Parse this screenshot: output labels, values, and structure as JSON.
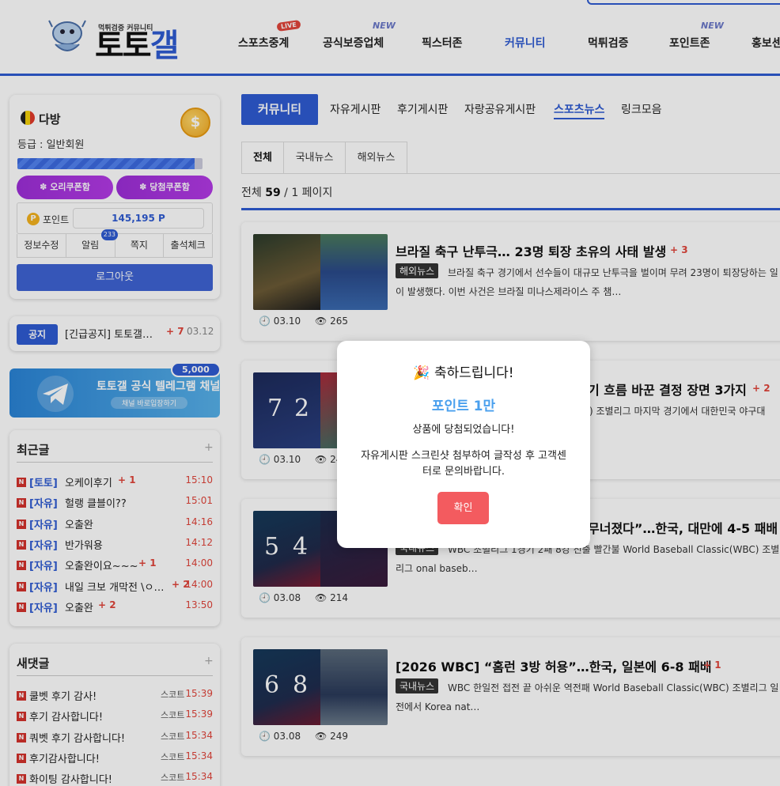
{
  "header": {
    "logo_sub": "먹튀검증 커뮤니티",
    "logo_main_a": "토토",
    "logo_main_b": "갤",
    "nav": [
      {
        "label": "스포츠중계",
        "badge": "LIVE"
      },
      {
        "label": "공식보증업체",
        "badge": "NEW"
      },
      {
        "label": "픽스터존",
        "badge": ""
      },
      {
        "label": "커뮤니티",
        "badge": ""
      },
      {
        "label": "먹튀검증",
        "badge": ""
      },
      {
        "label": "포인트존",
        "badge": "NEW"
      },
      {
        "label": "홍보센",
        "badge": ""
      }
    ]
  },
  "profile": {
    "nickname": "다방",
    "grade": "등급 : 일반회원",
    "coupon1": "✽ 오리쿠폰함",
    "coupon2": "✽ 당첨쿠폰함",
    "point_label": "포인트",
    "point_value": "145,195 P",
    "menu": [
      "정보수정",
      "알림",
      "쪽지",
      "출석체크"
    ],
    "alarm_count": "233",
    "logout": "로그아웃"
  },
  "notice": {
    "tag": "공지",
    "title": "[긴급공지] 토토갤…",
    "count": "+ 7",
    "date": "03.12"
  },
  "banner": {
    "title": "토토갤 공식 텔레그램 채널",
    "sub": "채널 바로입장하기",
    "badge": "5,000"
  },
  "recent": {
    "heading": "최근글",
    "items": [
      {
        "cat": "[토토]",
        "title": "오케이후기",
        "count": "+ 1",
        "time": "15:10"
      },
      {
        "cat": "[자유]",
        "title": "헐랭 클블이??",
        "count": "",
        "time": "15:01"
      },
      {
        "cat": "[자유]",
        "title": "오출완",
        "count": "",
        "time": "14:16"
      },
      {
        "cat": "[자유]",
        "title": "반가워용",
        "count": "",
        "time": "14:12"
      },
      {
        "cat": "[자유]",
        "title": "오출완이요~~~",
        "count": "+ 1",
        "time": "14:00"
      },
      {
        "cat": "[자유]",
        "title": "내일 크보 개막전 \\ㅇ…",
        "count": "+ 2",
        "time": "14:00"
      },
      {
        "cat": "[자유]",
        "title": "오출완",
        "count": "+ 2",
        "time": "13:50"
      }
    ]
  },
  "newreply": {
    "heading": "새댓글",
    "items": [
      {
        "title": "쿨벳 후기 감사!",
        "writer": "스코트",
        "time": "15:39"
      },
      {
        "title": "후기 감사합니다!",
        "writer": "스코트",
        "time": "15:39"
      },
      {
        "title": "쿼벳 후기 감사합니다!",
        "writer": "스코트",
        "time": "15:34"
      },
      {
        "title": "후기감사합니다!",
        "writer": "스코트",
        "time": "15:34"
      },
      {
        "title": "화이팅 감사합니다!",
        "writer": "스코트",
        "time": "15:34"
      }
    ]
  },
  "main": {
    "tab_main": "커뮤니티",
    "subnav": [
      "자유게시판",
      "후기게시판",
      "자랑공유게시판",
      "스포츠뉴스",
      "링크모음"
    ],
    "tabs": [
      "전체",
      "국내뉴스",
      "해외뉴스"
    ],
    "count_prefix": "전체",
    "count_total": "59",
    "count_suffix": "/ 1 페이지",
    "posts": [
      {
        "title": "브라질 축구 난투극… 23명 퇴장 초유의 사태 발생",
        "count": "+ 3",
        "cat": "해외뉴스",
        "desc": "브라질 축구 경기에서 선수들이 대규모 난투극을 벌이며 무려 23명이 퇴장당하는 일이 발생했다. 이번 사건은 브라질 미나스제라이스 주 챔…",
        "date": "03.10",
        "views": "265"
      },
      {
        "title": "기 흐름 바꾼 결정 장면 3가지",
        "count": "+ 2",
        "cat": "",
        "desc": ") 조별리그 마지막 경기에서 대한민국 야구대",
        "date": "03.10",
        "views": "24",
        "score": [
          "7",
          "2"
        ]
      },
      {
        "title": "무너졌다”…한국, 대만에 4-5 패배",
        "count": "",
        "cat": "국내뉴스",
        "desc": "WBC 조별리그 1경기 2패 8강 진출 빨간불 World Baseball Classic(WBC) 조별리그 onal baseb…",
        "date": "03.08",
        "views": "214",
        "score": [
          "5",
          "4"
        ]
      },
      {
        "title": "[2026 WBC] “홈런 3방 허용”…한국, 일본에 6-8 패배",
        "count": "+ 1",
        "cat": "국내뉴스",
        "desc": "WBC 한일전 접전 끝 아쉬운 역전패 World Baseball Classic(WBC) 조별리그 일전에서 Korea nat…",
        "date": "03.08",
        "views": "249",
        "score": [
          "6",
          "8"
        ]
      }
    ]
  },
  "modal": {
    "title": "🎉 축하드립니다!",
    "point": "포인트 1만",
    "line1": "상품에 당첨되었습니다!",
    "line2": "자유게시판 스크린샷 첨부하여 글작성 후 고객센터로 문의바랍니다.",
    "button": "확인"
  }
}
